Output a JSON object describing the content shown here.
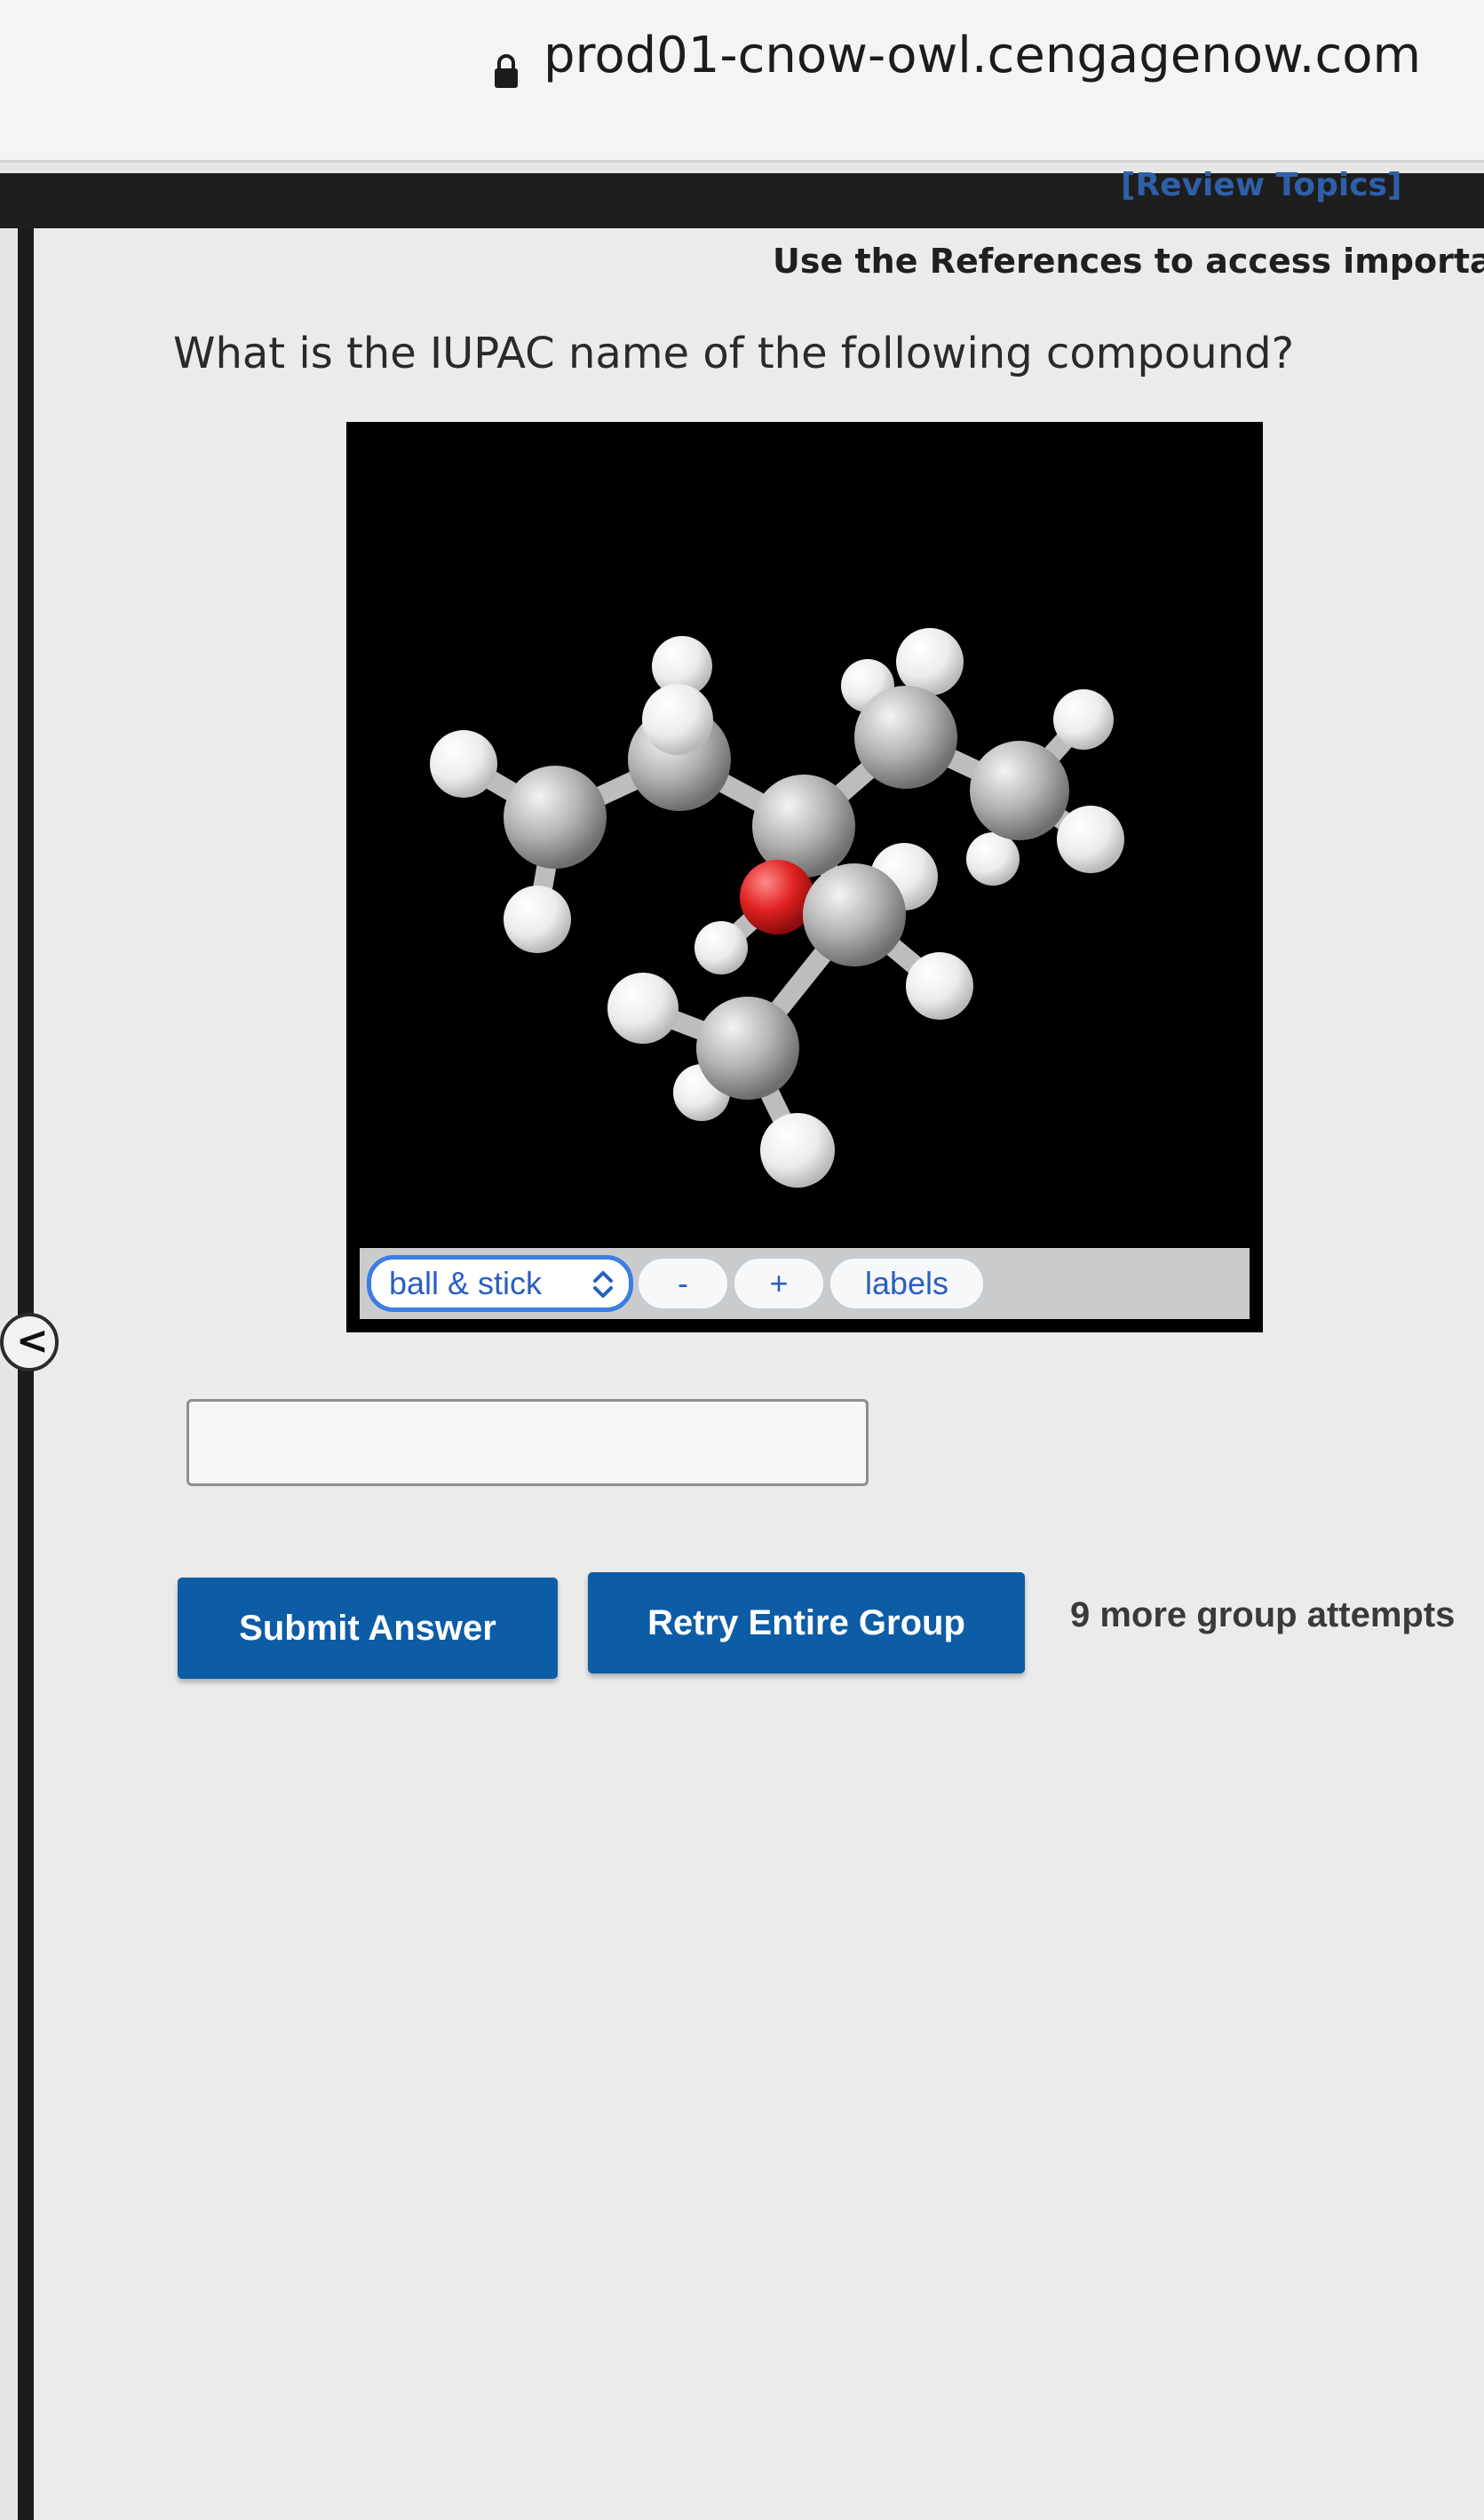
{
  "browser": {
    "url": "prod01-cnow-owl.cengagenow.com"
  },
  "header": {
    "review_topics": "[Review Topics]",
    "references_text": "Use the References to access important"
  },
  "question": {
    "text": "What is the IUPAC name of the following compound?"
  },
  "viewer": {
    "mode_label": "ball & stick",
    "minus_label": "-",
    "plus_label": "+",
    "labels_label": "labels",
    "colors": {
      "background": "#000000",
      "carbon": "#a9a9a9",
      "hydrogen": "#f0f0f0",
      "oxygen": "#e02020"
    }
  },
  "answer": {
    "value": "",
    "placeholder": ""
  },
  "actions": {
    "submit_label": "Submit Answer",
    "retry_label": "Retry Entire Group",
    "attempts_text": "9 more group attempts"
  },
  "colors": {
    "button": "#0d5ca6",
    "link": "#2f5fa8",
    "accent": "#3b7de3"
  },
  "icons": {
    "lock": "lock-icon",
    "chevron": "chevron-updown-icon",
    "collapse": "chevron-left-icon"
  }
}
